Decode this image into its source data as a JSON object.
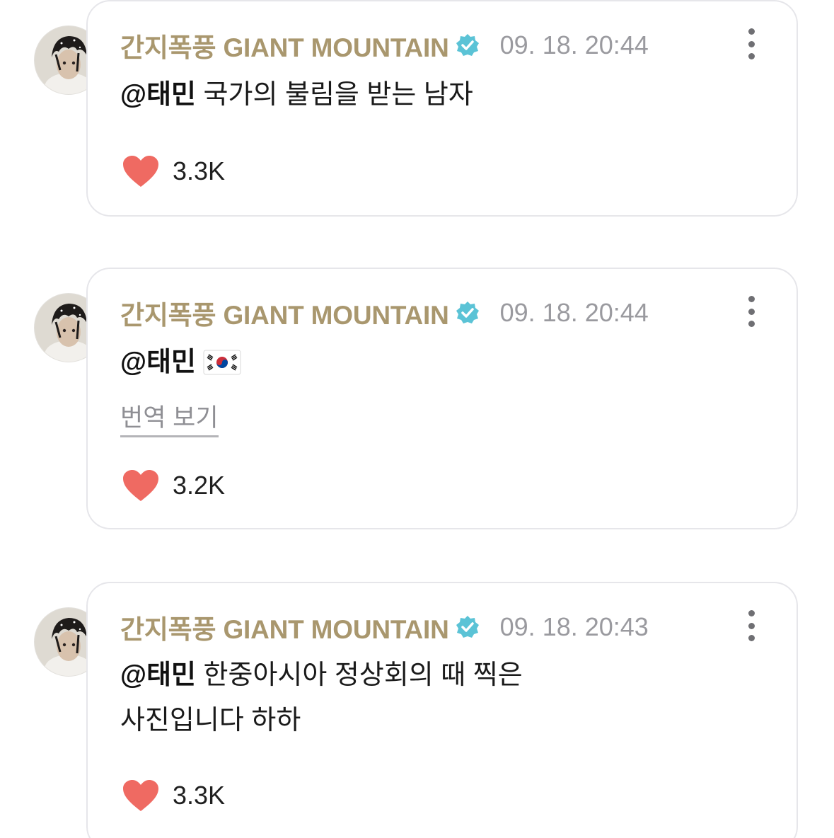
{
  "colors": {
    "author": "#a9976e",
    "timestamp": "#9a9a9f",
    "verified_badge": "#5bc3d6",
    "heart": "#ef6a62",
    "card_border": "#e6e6ea"
  },
  "icons": {
    "verified": "verified-badge-icon",
    "more": "more-vertical-icon",
    "like": "heart-icon",
    "flag": "south-korea-flag-emoji"
  },
  "posts": [
    {
      "author": "간지폭풍 GIANT MOUNTAIN",
      "timestamp": "09. 18. 20:44",
      "mention": "@태민",
      "text": " 국가의 불림을 받는 남자",
      "likes": "3.3K"
    },
    {
      "author": "간지폭풍 GIANT MOUNTAIN",
      "timestamp": "09. 18. 20:44",
      "mention": "@태민",
      "text": "",
      "translate_label": "번역 보기",
      "likes": "3.2K"
    },
    {
      "author": "간지폭풍 GIANT MOUNTAIN",
      "timestamp": "09. 18. 20:43",
      "mention": "@태민",
      "text": " 한중아시아 정상회의 때 찍은",
      "text_line2": "사진입니다 하하",
      "likes": "3.3K"
    }
  ]
}
